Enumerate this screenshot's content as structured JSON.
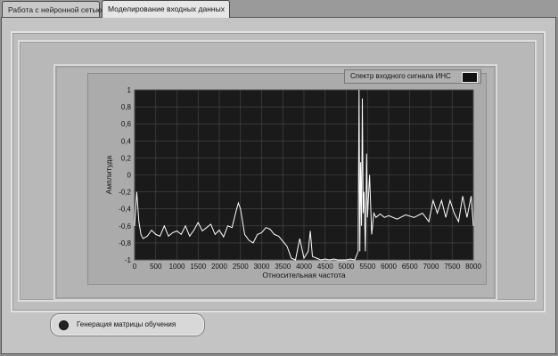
{
  "tabs": [
    {
      "label": "Работа с нейронной сетью",
      "active": false
    },
    {
      "label": "Моделирование входных данных",
      "active": true
    }
  ],
  "button": {
    "label": "Генерация матрицы обучения"
  },
  "chart_data": {
    "type": "line",
    "legend": "Спектр входного сигнала ИНС",
    "xlabel": "Относительная частота",
    "ylabel": "Амплитуда",
    "xlim": [
      0,
      8000
    ],
    "ylim": [
      -1,
      1
    ],
    "x_ticks": [
      "0",
      "500",
      "1000",
      "1500",
      "2000",
      "2500",
      "3000",
      "3500",
      "4000",
      "4500",
      "5000",
      "5500",
      "6000",
      "6500",
      "7000",
      "7500",
      "8000"
    ],
    "y_ticks": [
      "1",
      "0,8",
      "0,6",
      "0,4",
      "0,2",
      "0",
      "-0,2",
      "-0,4",
      "-0,6",
      "-0,8",
      "-1"
    ],
    "grid": true,
    "series": [
      {
        "color": "#ffffff",
        "x": [
          0,
          50,
          100,
          150,
          200,
          300,
          400,
          500,
          600,
          700,
          800,
          900,
          1000,
          1100,
          1200,
          1300,
          1400,
          1500,
          1600,
          1700,
          1800,
          1900,
          2000,
          2100,
          2200,
          2300,
          2400,
          2450,
          2500,
          2550,
          2600,
          2700,
          2800,
          2900,
          3000,
          3100,
          3200,
          3300,
          3400,
          3500,
          3600,
          3700,
          3800,
          3900,
          4000,
          4100,
          4150,
          4200,
          4300,
          4400,
          4500,
          4600,
          4700,
          4800,
          4900,
          5000,
          5100,
          5200,
          5280,
          5300,
          5320,
          5340,
          5360,
          5380,
          5400,
          5420,
          5450,
          5480,
          5500,
          5550,
          5600,
          5650,
          5700,
          5800,
          5900,
          6000,
          6200,
          6400,
          6600,
          6800,
          6950,
          7050,
          7150,
          7250,
          7350,
          7450,
          7550,
          7650,
          7750,
          7850,
          7950,
          8000
        ],
        "y": [
          -0.6,
          -0.2,
          -0.55,
          -0.7,
          -0.75,
          -0.72,
          -0.65,
          -0.7,
          -0.72,
          -0.6,
          -0.72,
          -0.68,
          -0.66,
          -0.7,
          -0.6,
          -0.72,
          -0.65,
          -0.56,
          -0.66,
          -0.62,
          -0.58,
          -0.7,
          -0.65,
          -0.73,
          -0.6,
          -0.62,
          -0.42,
          -0.33,
          -0.4,
          -0.55,
          -0.7,
          -0.77,
          -0.8,
          -0.7,
          -0.68,
          -0.62,
          -0.64,
          -0.7,
          -0.72,
          -0.78,
          -0.84,
          -0.98,
          -1.0,
          -0.75,
          -0.98,
          -0.9,
          -0.66,
          -0.96,
          -0.98,
          -1.0,
          -0.99,
          -1.0,
          -0.99,
          -1.0,
          -1.0,
          -1.0,
          -0.99,
          -1.0,
          -0.9,
          1.0,
          -0.9,
          0.15,
          -0.6,
          0.9,
          -0.45,
          -0.2,
          -0.9,
          0.25,
          -0.5,
          0.0,
          -0.7,
          -0.45,
          -0.5,
          -0.46,
          -0.5,
          -0.48,
          -0.52,
          -0.47,
          -0.5,
          -0.45,
          -0.55,
          -0.3,
          -0.45,
          -0.3,
          -0.5,
          -0.3,
          -0.45,
          -0.55,
          -0.25,
          -0.5,
          -0.25,
          -0.6
        ]
      }
    ]
  }
}
